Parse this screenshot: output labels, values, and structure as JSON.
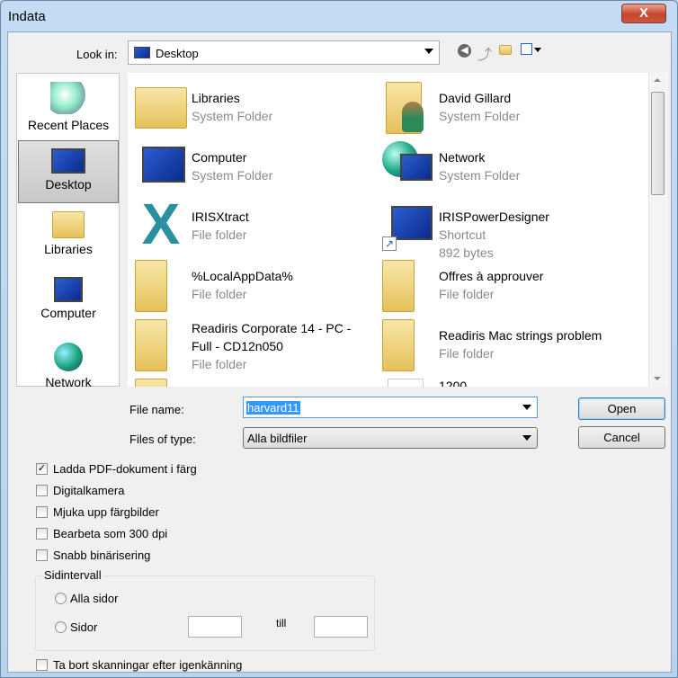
{
  "window": {
    "title": "Indata",
    "close_label": "X"
  },
  "lookin": {
    "label": "Look in:",
    "value": "Desktop"
  },
  "toolbar": {
    "icons": [
      "back-icon",
      "up-folder-icon",
      "new-folder-icon",
      "view-menu-icon"
    ]
  },
  "places": [
    {
      "label": "Recent Places",
      "icon": "recent-places-icon"
    },
    {
      "label": "Desktop",
      "icon": "desktop-icon",
      "selected": true
    },
    {
      "label": "Libraries",
      "icon": "libraries-icon"
    },
    {
      "label": "Computer",
      "icon": "computer-icon"
    },
    {
      "label": "Network",
      "icon": "network-icon"
    }
  ],
  "files": [
    {
      "name": "Libraries",
      "sub": [
        "System Folder"
      ],
      "icon": "libraries-icon"
    },
    {
      "name": "David Gillard",
      "sub": [
        "System Folder"
      ],
      "icon": "user-folder-icon"
    },
    {
      "name": "Computer",
      "sub": [
        "System Folder"
      ],
      "icon": "computer-icon"
    },
    {
      "name": "Network",
      "sub": [
        "System Folder"
      ],
      "icon": "network-icon"
    },
    {
      "name": "IRISXtract",
      "sub": [
        "File folder"
      ],
      "icon": "irisxtract-icon"
    },
    {
      "name": "IRISPowerDesigner",
      "sub": [
        "Shortcut",
        "892 bytes"
      ],
      "icon": "shortcut-icon"
    },
    {
      "name": "%LocalAppData%",
      "sub": [
        "File folder"
      ],
      "icon": "folder-icon"
    },
    {
      "name": "Offres à approuver",
      "sub": [
        "File folder"
      ],
      "icon": "folder-icon"
    },
    {
      "name": "Readiris Corporate 14 - PC - Full - CD12n050",
      "sub": [
        "File folder"
      ],
      "icon": "folder-icon"
    },
    {
      "name": "Readiris Mac strings problem",
      "sub": [
        "File folder"
      ],
      "icon": "folder-icon"
    },
    {
      "name": "",
      "sub": [],
      "icon": "folder-icon"
    },
    {
      "name": "1200",
      "sub": [],
      "icon": "file-icon"
    }
  ],
  "filename": {
    "label": "File name:",
    "value": "harvard11"
  },
  "filetype": {
    "label": "Files of type:",
    "value": "Alla bildfiler"
  },
  "buttons": {
    "open": "Open",
    "cancel": "Cancel"
  },
  "options": [
    {
      "label": "Ladda PDF-dokument i färg",
      "checked": true
    },
    {
      "label": "Digitalkamera",
      "checked": false
    },
    {
      "label": "Mjuka upp färgbilder",
      "checked": false
    },
    {
      "label": "Bearbeta som 300 dpi",
      "checked": false
    },
    {
      "label": "Snabb binärisering",
      "checked": false
    }
  ],
  "range": {
    "title": "Sidintervall",
    "all": "Alla sidor",
    "pages": "Sidor",
    "to": "till",
    "from_value": "",
    "to_value": ""
  },
  "delete_scans": {
    "label": "Ta bort skanningar efter igenkänning",
    "checked": false
  }
}
